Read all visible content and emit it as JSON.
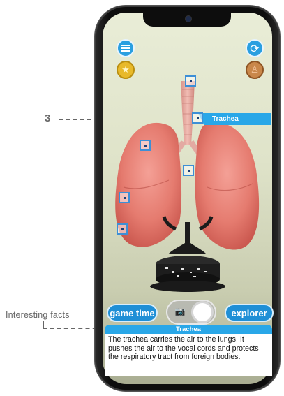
{
  "annotations": {
    "callout_number": "3",
    "facts_label": "Interesting facts"
  },
  "app": {
    "label_tag": "Trachea",
    "buttons": {
      "game_time": "game time",
      "explorer": "explorer"
    },
    "fact_panel": {
      "title": "Trachea",
      "text": "The trachea carries the air to the lungs. It pushes the air to the vocal cords and protects the respiratory tract from foreign bodies."
    },
    "icons": [
      "menu-icon",
      "coin-icon",
      "refresh-icon",
      "body-icon",
      "camera-icon",
      "shutter-icon"
    ],
    "colors": {
      "accent": "#29a7e8",
      "button": "#1f8fd6",
      "lung": "#e87f73"
    }
  }
}
